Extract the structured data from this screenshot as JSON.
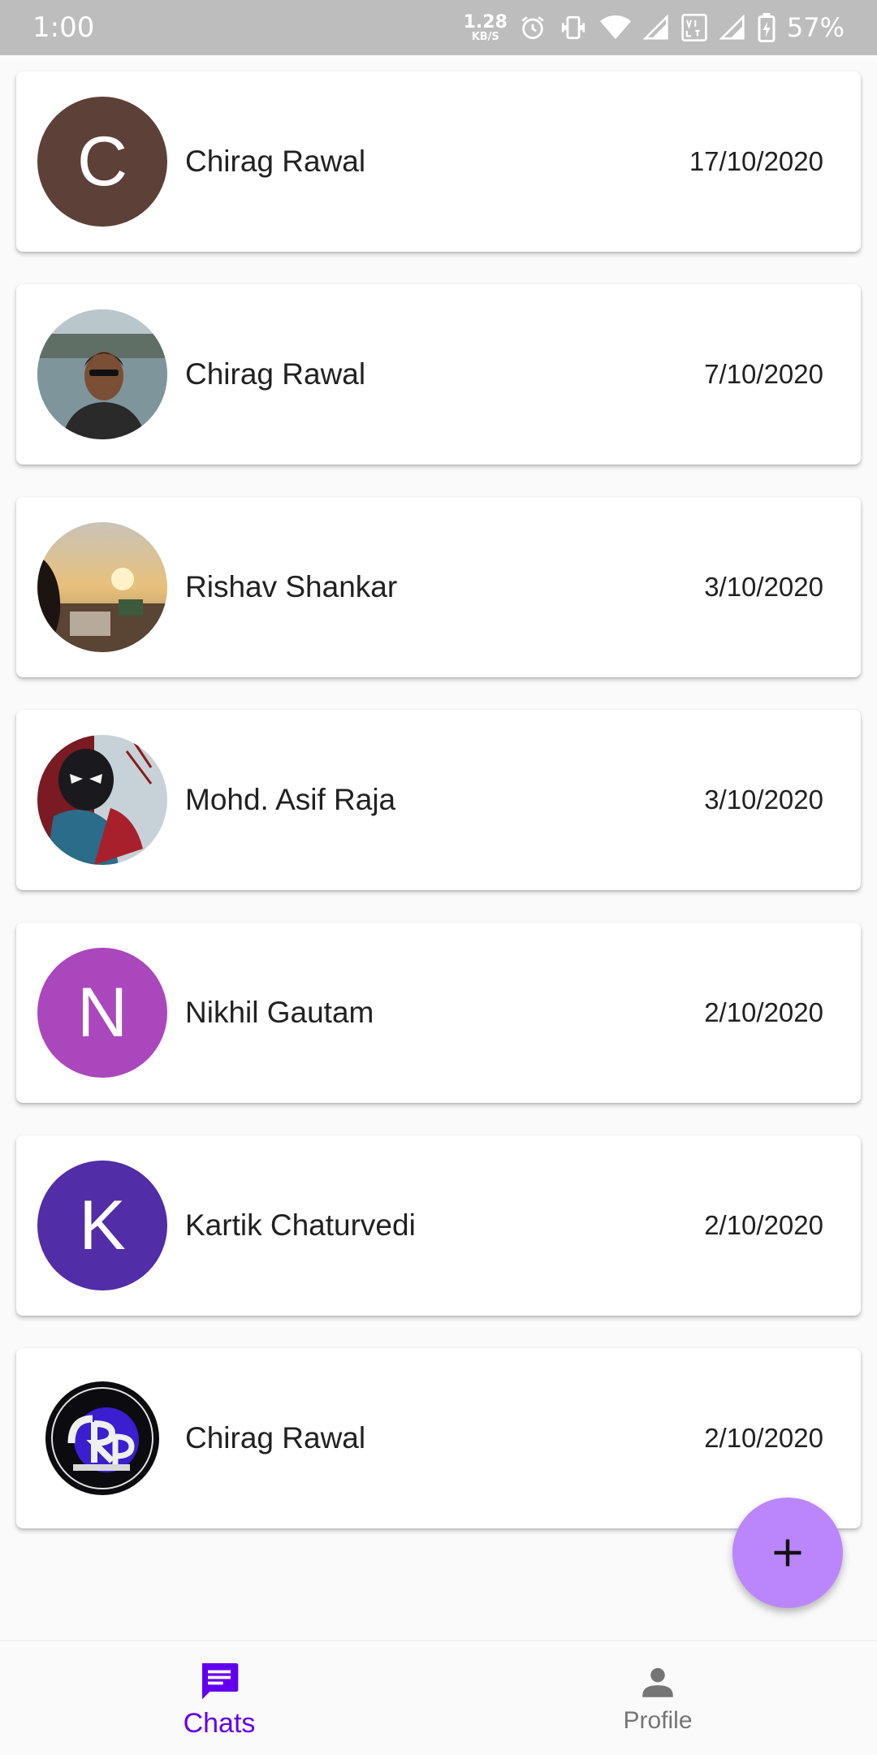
{
  "status_bar": {
    "time": "1:00",
    "net_speed_value": "1.28",
    "net_speed_unit": "KB/S",
    "battery_percent": "57%",
    "icons": [
      "alarm-icon",
      "vibrate-icon",
      "wifi-icon",
      "signal-icon",
      "volte-icon",
      "signal-icon",
      "battery-charging-icon"
    ]
  },
  "chats": [
    {
      "name": "Chirag Rawal",
      "date": "17/10/2020",
      "avatar_initial": "C",
      "avatar_color": "#5d4037"
    },
    {
      "name": "Chirag Rawal",
      "date": "7/10/2020",
      "avatar_type": "photo-person"
    },
    {
      "name": "Rishav Shankar",
      "date": "3/10/2020",
      "avatar_type": "photo-sunset"
    },
    {
      "name": "Mohd. Asif Raja",
      "date": "3/10/2020",
      "avatar_type": "photo-spiderman"
    },
    {
      "name": "Nikhil Gautam",
      "date": "2/10/2020",
      "avatar_initial": "N",
      "avatar_color": "#ab47bc"
    },
    {
      "name": "Kartik Chaturvedi",
      "date": "2/10/2020",
      "avatar_initial": "K",
      "avatar_color": "#512da8"
    },
    {
      "name": "Chirag Rawal",
      "date": "2/10/2020",
      "avatar_type": "logo-crp"
    }
  ],
  "fab": {
    "icon": "add-icon",
    "color": "#bb86fc"
  },
  "bottom_nav": {
    "items": [
      {
        "label": "Chats",
        "icon": "chat-icon",
        "active": true,
        "color": "#6200ee"
      },
      {
        "label": "Profile",
        "icon": "person-icon",
        "active": false,
        "color": "#757575"
      }
    ]
  }
}
